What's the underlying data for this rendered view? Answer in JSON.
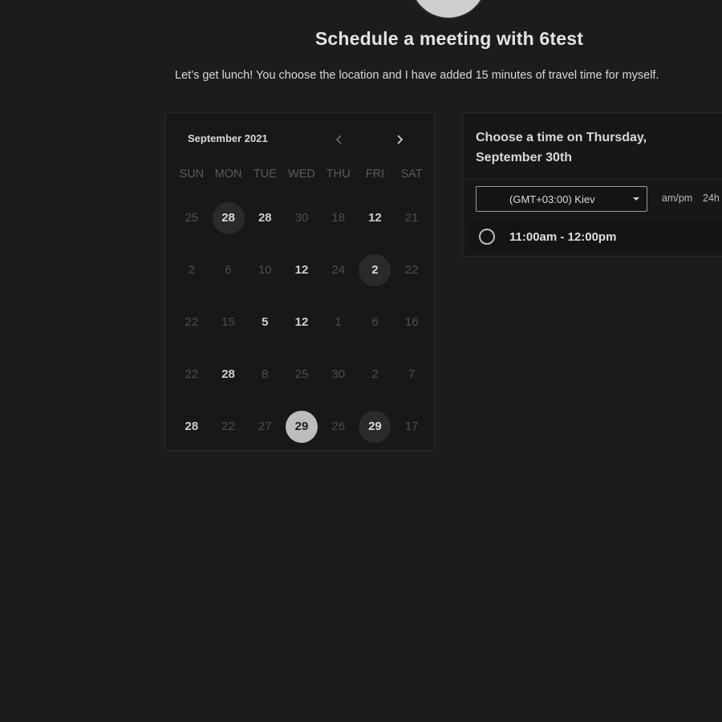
{
  "header": {
    "title": "Schedule a meeting with 6test",
    "description": "Let’s get lunch! You choose the location and I have added 15 minutes of travel time for myself."
  },
  "calendar": {
    "month_label": "September 2021",
    "weekdays": [
      "SUN",
      "MON",
      "TUE",
      "WED",
      "THU",
      "FRI",
      "SAT"
    ],
    "rows": [
      [
        {
          "d": "25",
          "s": ""
        },
        {
          "d": "28",
          "s": "ring"
        },
        {
          "d": "28",
          "s": "avail"
        },
        {
          "d": "30",
          "s": ""
        },
        {
          "d": "18",
          "s": ""
        },
        {
          "d": "12",
          "s": "avail"
        },
        {
          "d": "21",
          "s": ""
        }
      ],
      [
        {
          "d": "2",
          "s": ""
        },
        {
          "d": "6",
          "s": ""
        },
        {
          "d": "10",
          "s": ""
        },
        {
          "d": "12",
          "s": "avail"
        },
        {
          "d": "24",
          "s": ""
        },
        {
          "d": "2",
          "s": "ring"
        },
        {
          "d": "22",
          "s": ""
        }
      ],
      [
        {
          "d": "22",
          "s": ""
        },
        {
          "d": "15",
          "s": ""
        },
        {
          "d": "5",
          "s": "avail"
        },
        {
          "d": "12",
          "s": "avail"
        },
        {
          "d": "1",
          "s": ""
        },
        {
          "d": "6",
          "s": ""
        },
        {
          "d": "16",
          "s": ""
        }
      ],
      [
        {
          "d": "22",
          "s": ""
        },
        {
          "d": "28",
          "s": "avail"
        },
        {
          "d": "8",
          "s": ""
        },
        {
          "d": "25",
          "s": ""
        },
        {
          "d": "30",
          "s": ""
        },
        {
          "d": "2",
          "s": ""
        },
        {
          "d": "7",
          "s": ""
        }
      ],
      [
        {
          "d": "28",
          "s": "avail"
        },
        {
          "d": "22",
          "s": ""
        },
        {
          "d": "27",
          "s": ""
        },
        {
          "d": "29",
          "s": "selected"
        },
        {
          "d": "26",
          "s": ""
        },
        {
          "d": "29",
          "s": "ring"
        },
        {
          "d": "17",
          "s": ""
        }
      ]
    ]
  },
  "times": {
    "title": "Choose a time on Thursday, September 30th",
    "timezone": "(GMT+03:00) Kiev",
    "format_ampm": "am/pm",
    "format_24": "24h",
    "slots": [
      "11:00am - 12:00pm"
    ]
  },
  "icons": {
    "prev": "chevron-left-icon",
    "next": "chevron-right-icon",
    "radio": "radio-circle-icon",
    "dropdown": "caret-down-icon"
  }
}
